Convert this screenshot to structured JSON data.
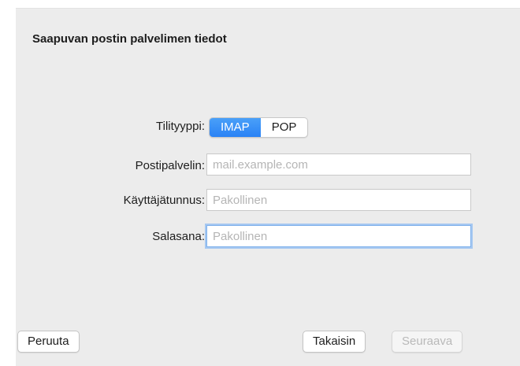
{
  "dialog": {
    "title": "Saapuvan postin palvelimen tiedot"
  },
  "account_type": {
    "label": "Tilityyppi:",
    "options": [
      "IMAP",
      "POP"
    ],
    "selected": "IMAP"
  },
  "mail_server": {
    "label": "Postipalvelin:",
    "value": "",
    "placeholder": "mail.example.com"
  },
  "username": {
    "label": "Käyttäjätunnus:",
    "value": "",
    "placeholder": "Pakollinen"
  },
  "password": {
    "label": "Salasana:",
    "value": "",
    "placeholder": "Pakollinen"
  },
  "buttons": {
    "cancel": "Peruuta",
    "back": "Takaisin",
    "next": "Seuraava"
  },
  "colors": {
    "accent": "#2a82f5",
    "background": "#ececec"
  }
}
